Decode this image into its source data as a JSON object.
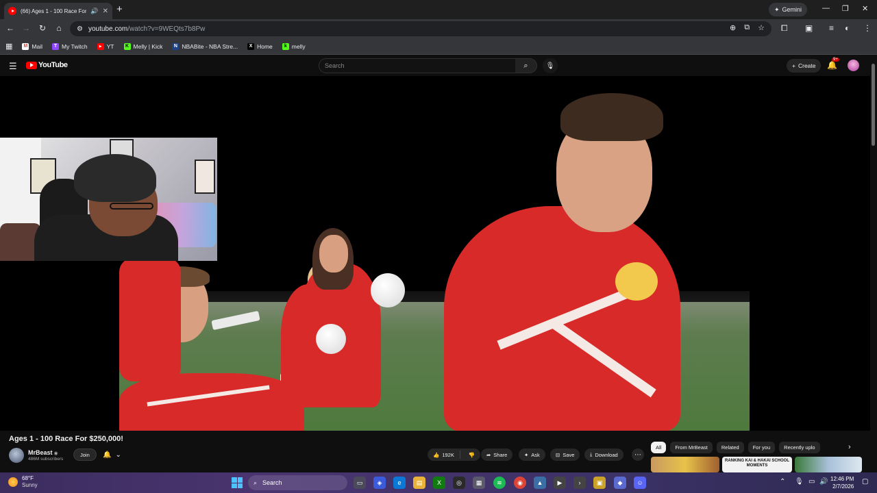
{
  "browser": {
    "tab_title": "(66) Ages 1 - 100 Race For $250,000!",
    "url_host": "youtube.com",
    "url_path": "/watch?v=9WEQts7b8Pw",
    "gemini_label": "Gemini",
    "bookmarks": [
      {
        "label": "Mail",
        "icon": "gmail-icon",
        "color": "#ea4335",
        "glyph": "M"
      },
      {
        "label": "My Twitch",
        "icon": "twitch-icon",
        "color": "#9146ff",
        "glyph": "T"
      },
      {
        "label": "YT",
        "icon": "youtube-icon",
        "color": "#ff0000",
        "glyph": "▶"
      },
      {
        "label": "Melly | Kick",
        "icon": "kick-icon",
        "color": "#53fc18",
        "glyph": "K"
      },
      {
        "label": "NBABite - NBA Stre...",
        "icon": "nba-icon",
        "color": "#c8102e",
        "glyph": "N"
      },
      {
        "label": "Home",
        "icon": "x-icon",
        "color": "#000000",
        "glyph": "X"
      },
      {
        "label": "melly",
        "icon": "kick-icon",
        "color": "#53fc18",
        "glyph": "k"
      }
    ]
  },
  "youtube": {
    "logo_text": "YouTube",
    "search_placeholder": "Search",
    "create_label": "Create",
    "notification_count": "9+"
  },
  "video": {
    "title": "Ages 1 - 100 Race For $250,000!",
    "channel": "MrBeast",
    "subscribers": "486M subscribers",
    "join_label": "Join",
    "likes": "192K",
    "share_label": "Share",
    "ask_label": "Ask",
    "save_label": "Save",
    "download_label": "Download"
  },
  "chips": [
    {
      "label": "All",
      "active": true
    },
    {
      "label": "From MrBeast",
      "active": false
    },
    {
      "label": "Related",
      "active": false
    },
    {
      "label": "For you",
      "active": false
    },
    {
      "label": "Recently uplo",
      "active": false
    }
  ],
  "thumbnail_text": "RANKING KAI & HAKAI SCHOOL MOMENTS",
  "taskbar": {
    "temperature": "68°F",
    "condition": "Sunny",
    "search_label": "Search",
    "time": "12:46 PM",
    "date": "2/7/2026"
  }
}
